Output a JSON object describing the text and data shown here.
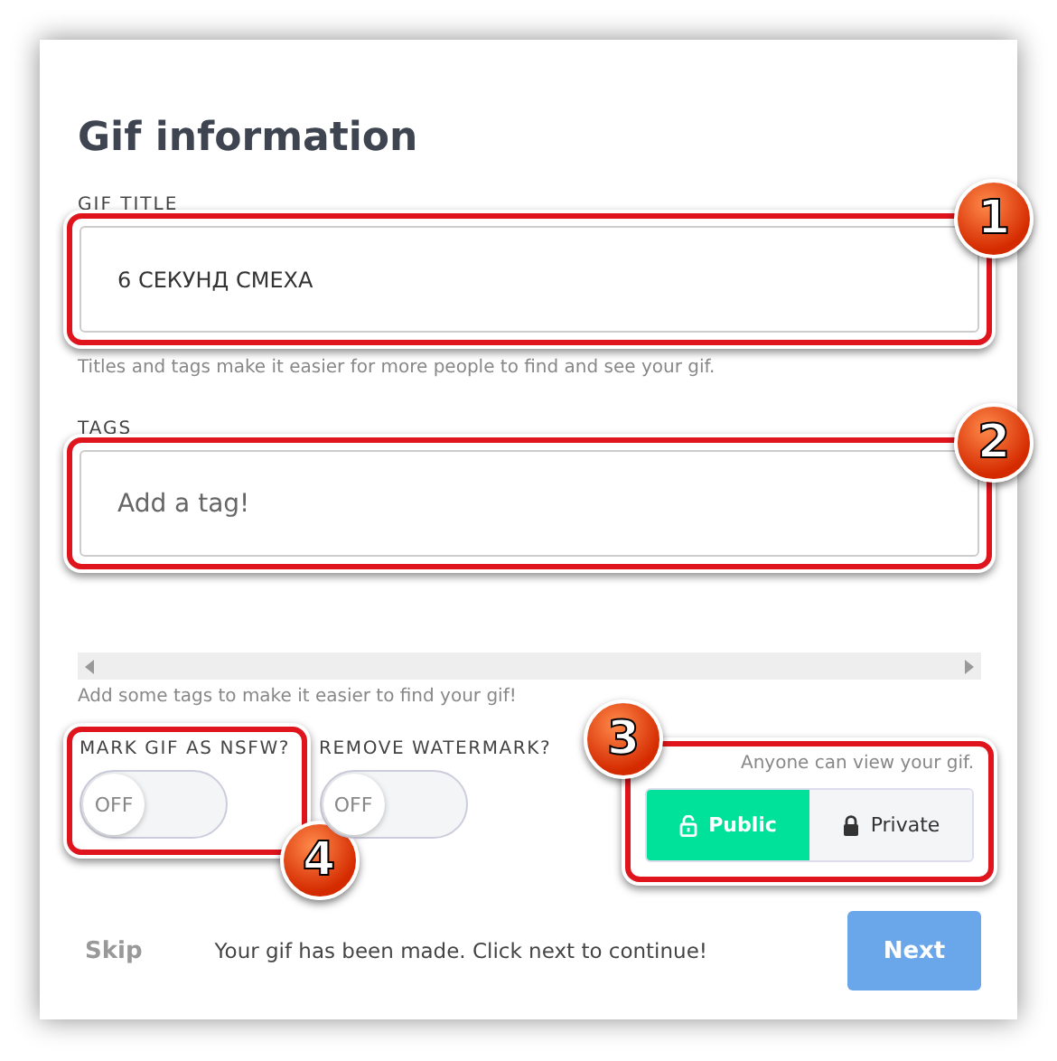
{
  "heading": "Gif information",
  "title_field": {
    "label": "GIF TITLE",
    "value": "6 СЕКУНД СМЕХА",
    "annotation": "1"
  },
  "title_hint": "Titles and tags make it easier for more people to find and see your gif.",
  "tags_field": {
    "label": "TAGS",
    "placeholder": "Add a tag!",
    "annotation": "2"
  },
  "tags_hint": "Add some tags to make it easier to find your gif!",
  "toggles": [
    {
      "label": "MARK GIF AS NSFW?",
      "state_text": "OFF",
      "on": false,
      "annotation": "4"
    },
    {
      "label": "REMOVE WATERMARK?",
      "state_text": "OFF",
      "on": false
    }
  ],
  "privacy": {
    "caption": "Anyone can view your gif.",
    "annotation": "3",
    "options": [
      {
        "label": "Public",
        "kind": "open",
        "selected": true
      },
      {
        "label": "Private",
        "kind": "locked",
        "selected": false
      }
    ]
  },
  "footer": {
    "skip": "Skip",
    "message": "Your gif has been made. Click next to continue!",
    "next": "Next"
  }
}
